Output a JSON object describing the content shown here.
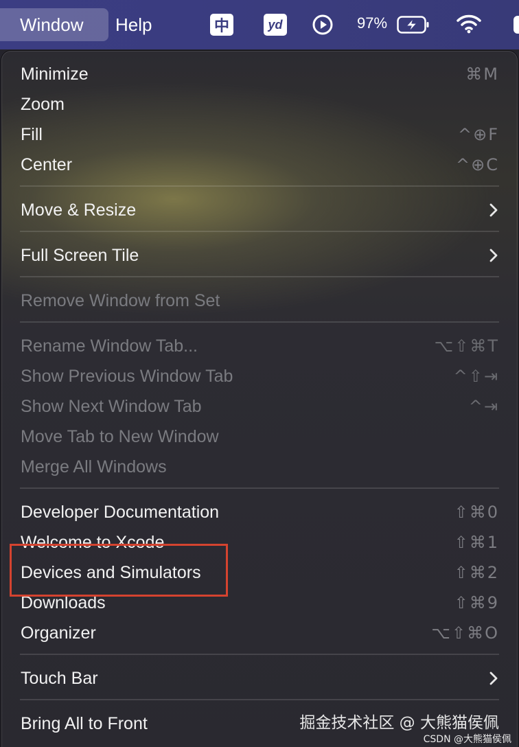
{
  "menubar": {
    "window_label": "Window",
    "help_label": "Help",
    "ime_label": "中",
    "yd_label": "yd",
    "battery_percent": "97%",
    "icons": [
      "input-method-icon",
      "youdao-icon",
      "play-icon",
      "battery-charging-icon",
      "wifi-icon",
      "control-center-icon"
    ]
  },
  "menu": {
    "items": [
      {
        "label": "Minimize",
        "shortcut": "⌘M",
        "enabled": true
      },
      {
        "label": "Zoom",
        "shortcut": "",
        "enabled": true
      },
      {
        "label": "Fill",
        "shortcut": "^⊕F",
        "enabled": true
      },
      {
        "label": "Center",
        "shortcut": "^⊕C",
        "enabled": true
      },
      {
        "label": "Move & Resize",
        "submenu": true,
        "enabled": true
      },
      {
        "label": "Full Screen Tile",
        "submenu": true,
        "enabled": true
      },
      {
        "label": "Remove Window from Set",
        "enabled": false
      },
      {
        "label": "Rename Window Tab...",
        "shortcut": "⌥⇧⌘T",
        "enabled": false
      },
      {
        "label": "Show Previous Window Tab",
        "shortcut": "^⇧⇥",
        "enabled": false
      },
      {
        "label": "Show Next Window Tab",
        "shortcut": "^⇥",
        "enabled": false
      },
      {
        "label": "Move Tab to New Window",
        "enabled": false
      },
      {
        "label": "Merge All Windows",
        "enabled": false
      },
      {
        "label": "Developer Documentation",
        "shortcut": "⇧⌘0",
        "enabled": true
      },
      {
        "label": "Welcome to Xcode",
        "shortcut": "⇧⌘1",
        "enabled": true
      },
      {
        "label": "Devices and Simulators",
        "shortcut": "⇧⌘2",
        "enabled": true,
        "highlighted": true
      },
      {
        "label": "Downloads",
        "shortcut": "⇧⌘9",
        "enabled": true
      },
      {
        "label": "Organizer",
        "shortcut": "⌥⇧⌘O",
        "enabled": true
      },
      {
        "label": "Touch Bar",
        "submenu": true,
        "enabled": true
      },
      {
        "label": "Bring All to Front",
        "enabled": true
      }
    ]
  },
  "annotation": {
    "highlight_color": "#d5432f"
  },
  "watermark": "掘金技术社区 @ 大熊猫侯佩",
  "credit": "CSDN @大熊猫侯佩"
}
